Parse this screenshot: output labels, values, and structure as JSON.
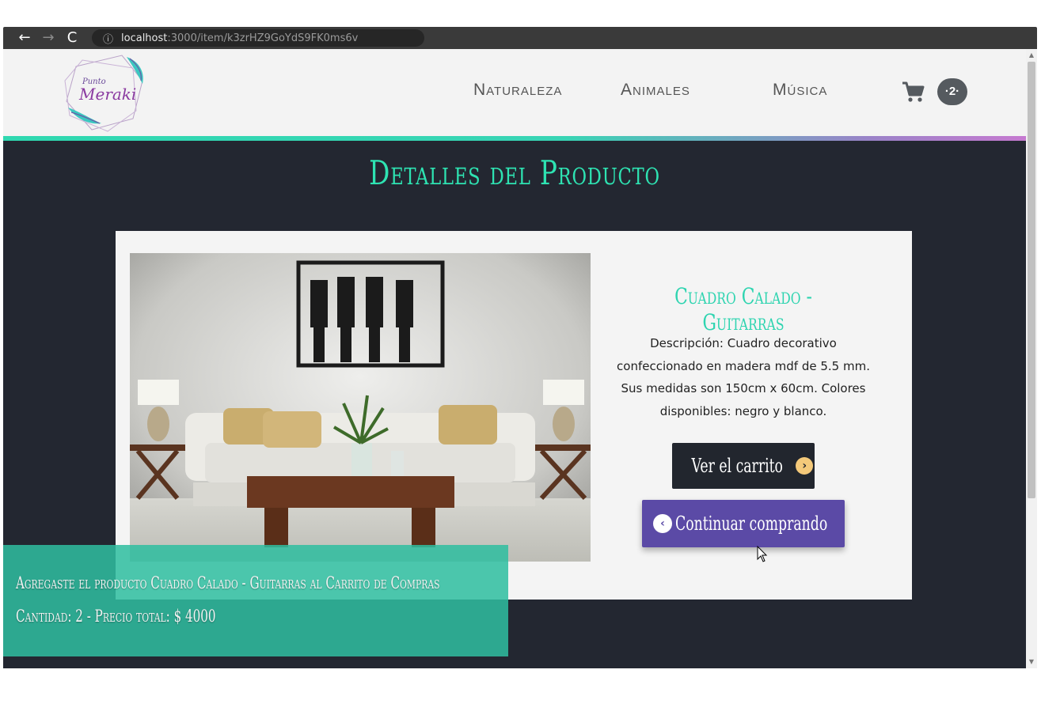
{
  "browser": {
    "back": "←",
    "forward": "→",
    "reload": "C",
    "info_icon": "ⓘ",
    "url_host": "localhost",
    "url_path": ":3000/item/k3zrHZ9GoYdS9FK0ms6v"
  },
  "header": {
    "logo_text_top": "Punto",
    "logo_text": "Meraki",
    "nav": [
      "Naturaleza",
      "Animales",
      "Música"
    ],
    "cart_icon": "cart-icon",
    "cart_count": "·2·"
  },
  "page": {
    "title": "Detalles del Producto"
  },
  "product": {
    "name": "Cuadro Calado - Guitarras",
    "description": "Descripción: Cuadro decorativo confeccionado en madera mdf de 5.5 mm. Sus medidas son 150cm x 60cm. Colores disponibles: negro y blanco."
  },
  "buttons": {
    "view_cart": "Ver el carrito",
    "view_cart_icon": "›",
    "continue": "Continuar comprando",
    "continue_icon": "‹"
  },
  "toast": {
    "line1": "Agregaste el producto Cuadro Calado - Guitarras al Carrito de Compras",
    "line2": "Cantidad: 2 - Precio total: $ 4000"
  },
  "colors": {
    "accent": "#2ee3b2",
    "dark": "#232731",
    "purple": "#5b4aa6"
  }
}
